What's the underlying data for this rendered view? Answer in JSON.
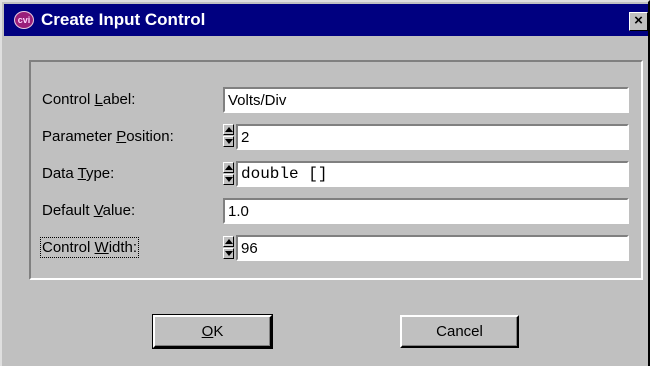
{
  "window": {
    "title": "Create Input Control",
    "icon": "cvi-app-icon",
    "icon_text": "cvi",
    "close_label": "×"
  },
  "fields": [
    {
      "label_pre": "Control ",
      "label_key": "L",
      "label_post": "abel:",
      "value": "Volts/Div",
      "has_spinner": false
    },
    {
      "label_pre": "Parameter ",
      "label_key": "P",
      "label_post": "osition:",
      "value": "2",
      "has_spinner": true
    },
    {
      "label_pre": "Data ",
      "label_key": "T",
      "label_post": "ype:",
      "value": "double []",
      "has_spinner": true
    },
    {
      "label_pre": "Default ",
      "label_key": "V",
      "label_post": "alue:",
      "value": "1.0",
      "has_spinner": false
    },
    {
      "label_pre": "Control ",
      "label_key": "W",
      "label_post": "idth:",
      "value": "96",
      "has_spinner": true,
      "focused": true
    }
  ],
  "buttons": {
    "ok": {
      "key": "O",
      "rest": "K"
    },
    "cancel": {
      "label": "Cancel"
    }
  }
}
